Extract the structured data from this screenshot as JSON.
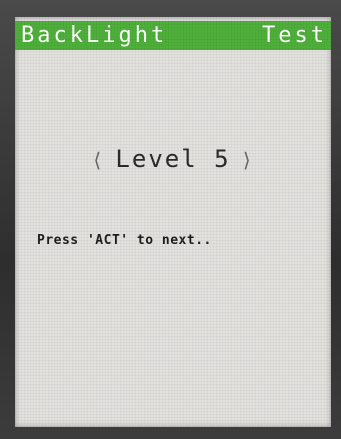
{
  "title": {
    "left": "BackLight",
    "right": "Test"
  },
  "level": {
    "left_bracket": "⟨",
    "label": "Level 5",
    "right_bracket": "⟩"
  },
  "hint": "Press 'ACT' to next..",
  "colors": {
    "title_bar": "#4eb03a",
    "screen_bg": "#e2e1de",
    "text": "#2a2a2a"
  }
}
